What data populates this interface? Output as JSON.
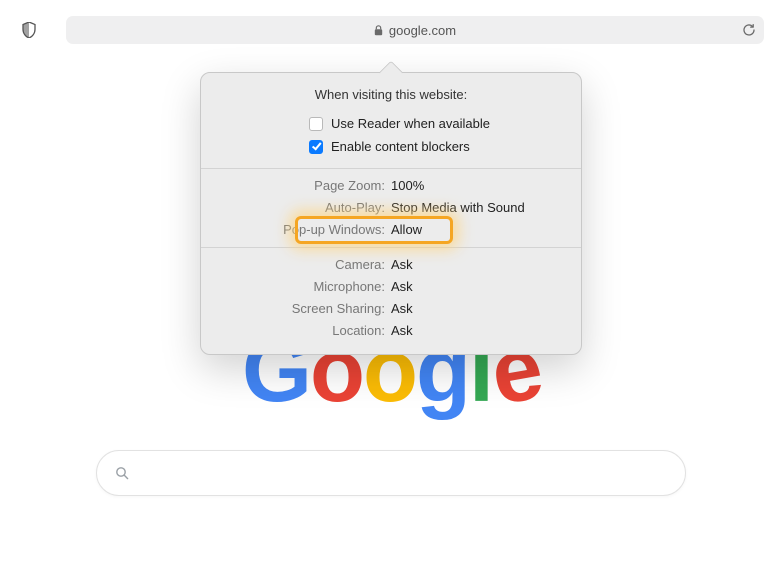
{
  "toolbar": {
    "domain": "google.com"
  },
  "logo": {
    "g1": "G",
    "o1": "o",
    "o2": "o",
    "g2": "g",
    "l": "l",
    "e": "e"
  },
  "search": {
    "placeholder": ""
  },
  "popover": {
    "header": "When visiting this website:",
    "reader_label": "Use Reader when available",
    "blockers_label": "Enable content blockers",
    "reader_checked": false,
    "blockers_checked": true,
    "settings1": [
      {
        "label": "Page Zoom:",
        "value": "100%"
      },
      {
        "label": "Auto-Play:",
        "value": "Stop Media with Sound"
      },
      {
        "label": "Pop-up Windows:",
        "value": "Allow"
      }
    ],
    "settings2": [
      {
        "label": "Camera:",
        "value": "Ask"
      },
      {
        "label": "Microphone:",
        "value": "Ask"
      },
      {
        "label": "Screen Sharing:",
        "value": "Ask"
      },
      {
        "label": "Location:",
        "value": "Ask"
      }
    ]
  }
}
